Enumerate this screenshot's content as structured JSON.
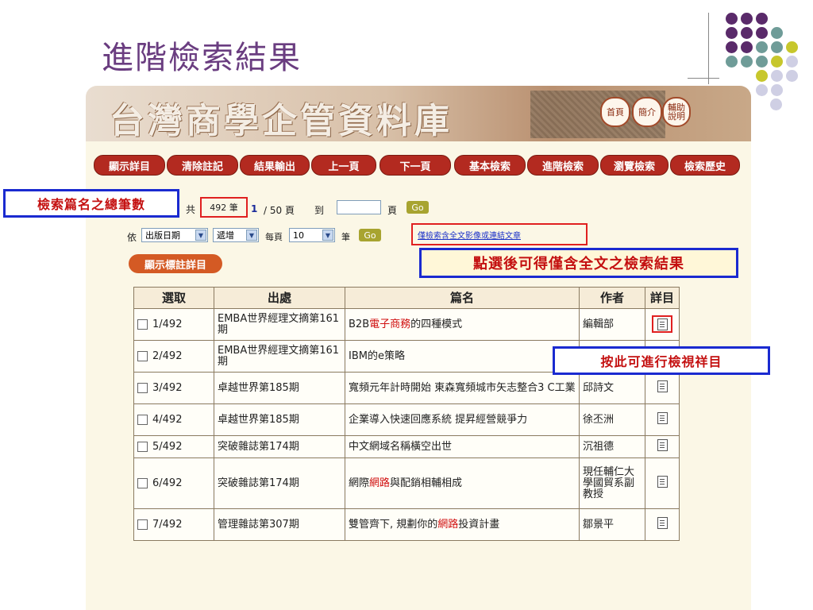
{
  "slide": {
    "title": "進階檢索結果"
  },
  "banner": {
    "title": "台灣商學企管資料庫",
    "buttons": [
      "首頁",
      "簡介",
      "輔助說明"
    ]
  },
  "nav": [
    "顯示詳目",
    "清除註記",
    "結果輸出",
    "上一頁",
    "下一頁",
    "基本檢索",
    "進階檢索",
    "瀏覽檢索",
    "檢索歷史"
  ],
  "paging": {
    "total_prefix": "共",
    "total": "492 筆",
    "current_page": "1",
    "of_pages": "/ 50 頁",
    "goto_label": "到",
    "page_suffix": "頁",
    "go": "Go"
  },
  "sorting": {
    "by_label": "依",
    "sort_field": "出版日期",
    "sort_order": "遞增",
    "per_page_label": "每頁",
    "per_page": "10",
    "unit": "筆",
    "go": "Go",
    "fulltext_link": "僅檢索含全文影像或連結文章"
  },
  "show_marked_button": "顯示標註詳目",
  "annotations": {
    "total_count": "檢索篇名之總筆數",
    "fulltext_only": "點選後可得僅含全文之檢索結果",
    "view_detail": "按此可進行檢視祥目"
  },
  "table": {
    "headers": [
      "選取",
      "出處",
      "篇名",
      "作者",
      "詳目"
    ],
    "rows": [
      {
        "num": "1/492",
        "source": "EMBA世界經理文摘第161期",
        "title_pre": "B2B",
        "title_hl": "電子商務",
        "title_post": "的四種模式",
        "author": "編輯部"
      },
      {
        "num": "2/492",
        "source": "EMBA世界經理文摘第161期",
        "title_pre": "IBM的e策略",
        "title_hl": "",
        "title_post": "",
        "author": ""
      },
      {
        "num": "3/492",
        "source": "卓越世界第185期",
        "title_pre": "寬頻元年計時開始 東森寬頻城市矢志整合3 C工業",
        "title_hl": "",
        "title_post": "",
        "author": "邱詩文"
      },
      {
        "num": "4/492",
        "source": "卓越世界第185期",
        "title_pre": "企業導入快速回應系統 提昇經營競爭力",
        "title_hl": "",
        "title_post": "",
        "author": "徐丕洲"
      },
      {
        "num": "5/492",
        "source": "突破雜誌第174期",
        "title_pre": "中文網域名稱橫空出世",
        "title_hl": "",
        "title_post": "",
        "author": "沉祖德"
      },
      {
        "num": "6/492",
        "source": "突破雜誌第174期",
        "title_pre": "網際",
        "title_hl": "網路",
        "title_post": "與配銷相輔相成",
        "author": "現任輔仁大學國貿系副教授"
      },
      {
        "num": "7/492",
        "source": "管理雜誌第307期",
        "title_pre": "雙管齊下, 規劃你的",
        "title_hl": "網路",
        "title_post": "投資計畫",
        "author": "鄒景平"
      }
    ]
  },
  "colors": {
    "purple": "#5a2a6a",
    "teal": "#6f9c98",
    "lime": "#c7c72c",
    "lavender": "#cfcfe4",
    "nav_red": "#b32a20",
    "annotation_red": "#c41010",
    "annotation_blue": "#1a2ad0"
  }
}
